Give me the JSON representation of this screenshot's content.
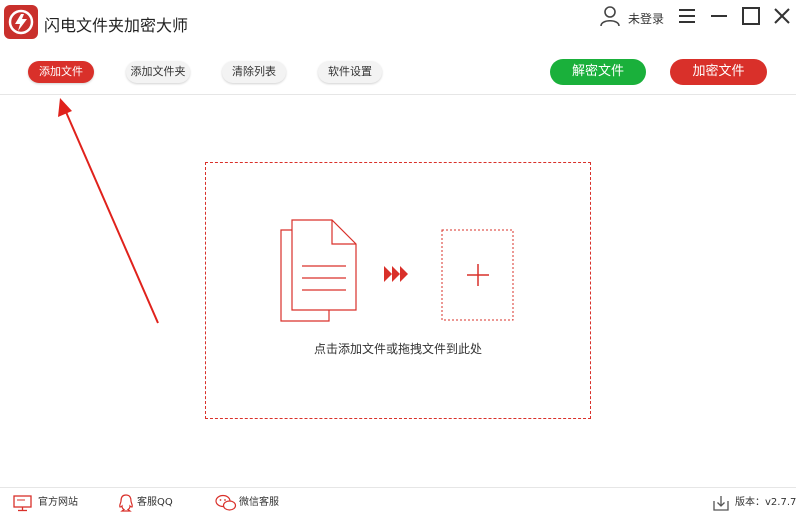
{
  "app": {
    "title": "闪电文件夹加密大师"
  },
  "header": {
    "user_label": "未登录"
  },
  "toolbar": {
    "add_file": "添加文件",
    "add_folder": "添加文件夹",
    "clear_list": "清除列表",
    "settings": "软件设置",
    "decrypt": "解密文件",
    "encrypt": "加密文件"
  },
  "dropzone": {
    "hint": "点击添加文件或拖拽文件到此处"
  },
  "footer": {
    "website": "官方网站",
    "qq": "客服QQ",
    "wechat": "微信客服",
    "version": "版本：v2.7.7"
  },
  "colors": {
    "accent": "#d9302a",
    "green": "#1ab03b"
  },
  "icons": {
    "logo": "app-logo-icon",
    "user": "user-icon",
    "menu": "menu-icon",
    "minimize": "minimize-icon",
    "maximize": "maximize-icon",
    "close": "close-icon",
    "files": "document-icon",
    "forward": "triple-chevron-icon",
    "plus": "plus-icon",
    "monitor": "monitor-icon",
    "qq": "qq-icon",
    "wechat": "wechat-icon",
    "download": "download-icon"
  }
}
